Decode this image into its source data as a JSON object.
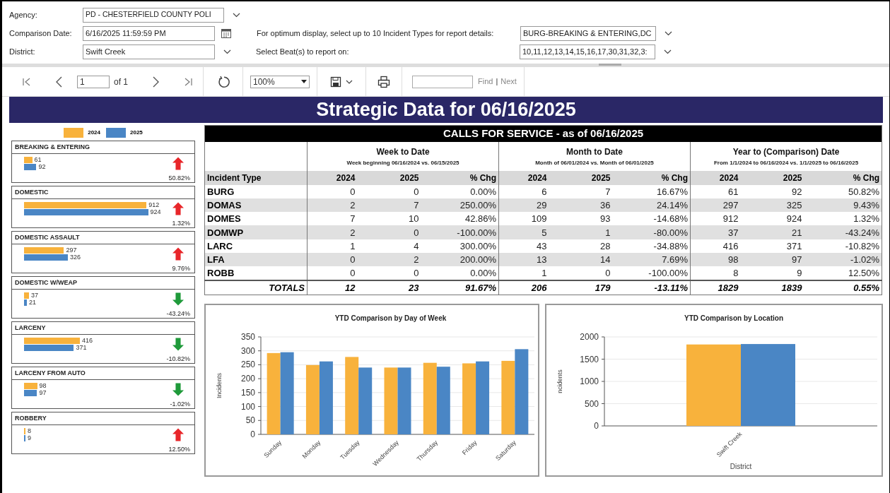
{
  "parameters": {
    "agency": {
      "label": "Agency:",
      "value": "PD - CHESTERFIELD COUNTY POLI"
    },
    "comparison_date": {
      "label": "Comparison Date:",
      "value": "6/16/2025 11:59:59 PM"
    },
    "incident_types": {
      "label": "For optimum display, select up to 10 Incident Types for report details:",
      "value": "BURG-BREAKING & ENTERING,DC"
    },
    "district": {
      "label": "District:",
      "value": "Swift Creek"
    },
    "beats": {
      "label": "Select Beat(s) to report on:",
      "value": "10,11,12,13,14,15,16,17,30,31,32,3:"
    }
  },
  "toolbar": {
    "page": "1",
    "page_count": "of 1",
    "zoom": "100%",
    "find": "Find",
    "separator": "|",
    "next": "Next"
  },
  "report_title": "Strategic Data for 06/16/2025",
  "legend": [
    {
      "label": "2024",
      "color": "#f8b23c"
    },
    {
      "label": "2025",
      "color": "#4a86c5"
    }
  ],
  "cards": [
    {
      "title": "BREAKING & ENTERING",
      "value_2024": "61",
      "value_2025": "92",
      "change": "50.82%",
      "increase": true
    },
    {
      "title": "DOMESTIC",
      "value_2024": "912",
      "value_2025": "924",
      "change": "1.32%",
      "increase": true
    },
    {
      "title": "DOMESTIC ASSAULT",
      "value_2024": "297",
      "value_2025": "326",
      "change": "9.76%",
      "increase": true
    },
    {
      "title": "DOMESTIC W/WEAP",
      "value_2024": "37",
      "value_2025": "21",
      "change": "-43.24%",
      "increase": false
    },
    {
      "title": "LARCENY",
      "value_2024": "416",
      "value_2025": "371",
      "change": "-10.82%",
      "increase": false
    },
    {
      "title": "LARCENY FROM AUTO",
      "value_2024": "98",
      "value_2025": "97",
      "change": "-1.02%",
      "increase": false
    },
    {
      "title": "ROBBERY",
      "value_2024": "8",
      "value_2025": "9",
      "change": "12.50%",
      "increase": true
    }
  ],
  "table": {
    "title": "CALLS FOR SERVICE - as of 06/16/2025",
    "groups": [
      {
        "title": "Week to Date",
        "subtitle": "Week beginning 06/16/2024 vs. 06/15/2025"
      },
      {
        "title": "Month to Date",
        "subtitle": "Month of 06/01/2024 vs. Month of 06/01/2025"
      },
      {
        "title": "Year to (Comparison) Date",
        "subtitle": "From 1/1/2024 to 06/16/2024 vs. 1/1/2025 to 06/16/2025"
      }
    ],
    "columns": [
      "Incident Type",
      "2024",
      "2025",
      "% Chg",
      "2024",
      "2025",
      "% Chg",
      "2024",
      "2025",
      "% Chg"
    ],
    "rows": [
      [
        "BURG",
        "0",
        "0",
        "0.00%",
        "6",
        "7",
        "16.67%",
        "61",
        "92",
        "50.82%"
      ],
      [
        "DOMAS",
        "2",
        "7",
        "250.00%",
        "29",
        "36",
        "24.14%",
        "297",
        "325",
        "9.43%"
      ],
      [
        "DOMES",
        "7",
        "10",
        "42.86%",
        "109",
        "93",
        "-14.68%",
        "912",
        "924",
        "1.32%"
      ],
      [
        "DOMWP",
        "2",
        "0",
        "-100.00%",
        "5",
        "1",
        "-80.00%",
        "37",
        "21",
        "-43.24%"
      ],
      [
        "LARC",
        "1",
        "4",
        "300.00%",
        "43",
        "28",
        "-34.88%",
        "416",
        "371",
        "-10.82%"
      ],
      [
        "LFA",
        "0",
        "2",
        "200.00%",
        "13",
        "14",
        "7.69%",
        "98",
        "97",
        "-1.02%"
      ],
      [
        "ROBB",
        "0",
        "0",
        "0.00%",
        "1",
        "0",
        "-100.00%",
        "8",
        "9",
        "12.50%"
      ]
    ],
    "totals": [
      "TOTALS",
      "12",
      "23",
      "91.67%",
      "206",
      "179",
      "-13.11%",
      "1829",
      "1839",
      "0.55%"
    ]
  },
  "charts": [
    {
      "chart_data": {
        "type": "bar",
        "title": "YTD Comparison by Day of Week",
        "ylabel": "Incidents",
        "categories": [
          "Sunday",
          "Monday",
          "Tuesday",
          "Wednesday",
          "Thursday",
          "Friday",
          "Saturday"
        ],
        "series": [
          {
            "color": "#f8b23c",
            "values": [
              292,
              249,
              278,
              240,
              257,
              255,
              264
            ]
          },
          {
            "color": "#4a86c5",
            "values": [
              295,
              262,
              240,
              240,
              243,
              262,
              306
            ]
          }
        ],
        "ylim": [
          0,
          350
        ],
        "yticks": [
          0,
          50,
          100,
          150,
          200,
          250,
          300,
          350
        ],
        "grid": true
      }
    },
    {
      "chart_data": {
        "type": "bar",
        "title": "YTD Comparison by Location",
        "ylabel": "ncidents",
        "xlabel": "District",
        "categories": [
          "Swift Creek"
        ],
        "series": [
          {
            "color": "#f8b23c",
            "values": [
              1830
            ]
          },
          {
            "color": "#4a86c5",
            "values": [
              1840
            ]
          }
        ],
        "ylim": [
          0,
          2000
        ],
        "yticks": [
          0,
          500,
          1000,
          1500,
          2000
        ],
        "grid": true
      }
    }
  ]
}
